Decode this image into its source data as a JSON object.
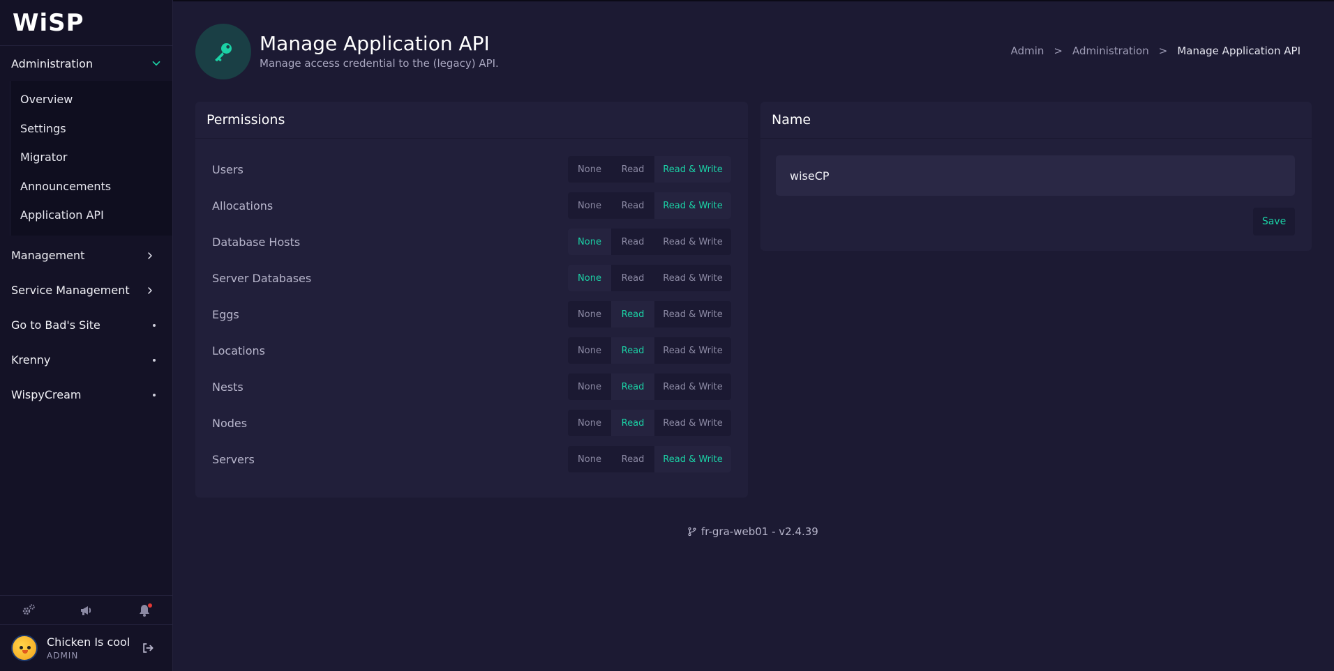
{
  "brand": {
    "logo_text": "WiSP"
  },
  "sidebar": {
    "administration": {
      "label": "Administration",
      "items": [
        "Overview",
        "Settings",
        "Migrator",
        "Announcements",
        "Application API"
      ]
    },
    "sections": [
      {
        "label": "Management",
        "indicator": "chevron"
      },
      {
        "label": "Service Management",
        "indicator": "chevron"
      },
      {
        "label": "Go to Bad's Site",
        "indicator": "dot"
      },
      {
        "label": "Krenny",
        "indicator": "dot"
      },
      {
        "label": "WispyCream",
        "indicator": "dot"
      }
    ],
    "user": {
      "name": "Chicken Is cool",
      "role": "ADMIN"
    }
  },
  "header": {
    "title": "Manage Application API",
    "subtitle": "Manage access credential to the (legacy) API.",
    "breadcrumbs": [
      "Admin",
      "Administration",
      "Manage Application API"
    ],
    "separator": ">"
  },
  "permissions": {
    "title": "Permissions",
    "options": [
      "None",
      "Read",
      "Read & Write"
    ],
    "rows": [
      {
        "label": "Users",
        "selected": "Read & Write"
      },
      {
        "label": "Allocations",
        "selected": "Read & Write"
      },
      {
        "label": "Database Hosts",
        "selected": "None"
      },
      {
        "label": "Server Databases",
        "selected": "None"
      },
      {
        "label": "Eggs",
        "selected": "Read"
      },
      {
        "label": "Locations",
        "selected": "Read"
      },
      {
        "label": "Nests",
        "selected": "Read"
      },
      {
        "label": "Nodes",
        "selected": "Read"
      },
      {
        "label": "Servers",
        "selected": "Read & Write"
      }
    ]
  },
  "name_panel": {
    "title": "Name",
    "value": "wiseCP",
    "save_label": "Save"
  },
  "footer": {
    "version": "fr-gra-web01 - v2.4.39"
  },
  "colors": {
    "accent": "#1bd1a5",
    "background": "#1c1a33",
    "sidebar": "#141226",
    "panel": "#211f3a",
    "notification": "#e53935"
  }
}
